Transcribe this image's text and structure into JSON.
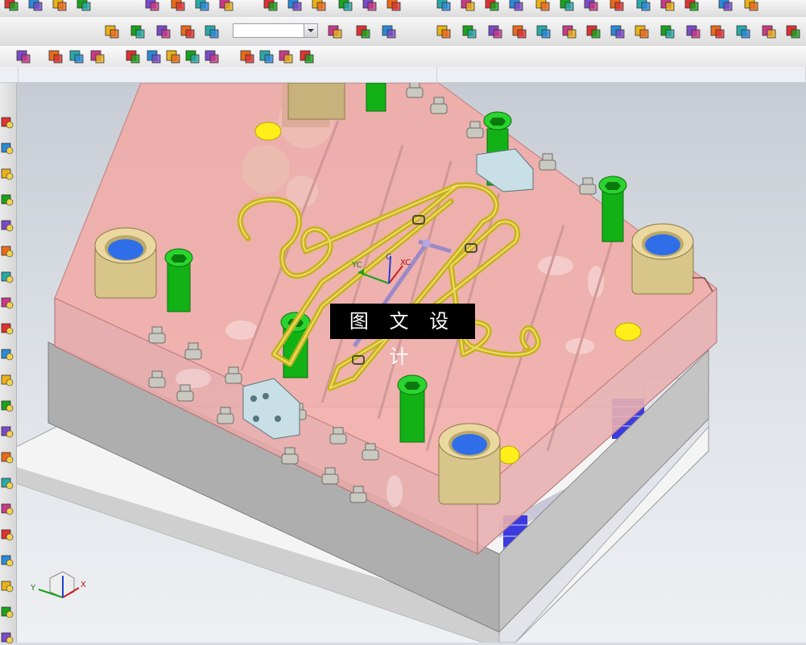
{
  "toolbar": {
    "combo_value": ""
  },
  "viewport": {
    "watermark_text": "图 文 设 计",
    "wcs_label_yc": "YC",
    "wcs_label_xc": "XC",
    "wcs_label_zc": "C",
    "triad_label_x": "X",
    "triad_label_y": "Y"
  },
  "colors": {
    "plate_pink": "#f2a5a1",
    "hanger_yellow": "#c8b21a",
    "bolt_green": "#16b81a",
    "bushing_blue": "#2f6ee8",
    "bushing_brass": "#e3d09a"
  },
  "icons": {
    "toolbar_row1": [
      "sketch-icon",
      "dimension-icon",
      "home-icon",
      "cylinder-icon",
      "check-icon",
      "table-icon",
      "edit-icon",
      "view-icon",
      "analysis-icon",
      "grid-icon",
      "cube-icon",
      "box-icon",
      "move-icon",
      "tools-icon",
      "layer-icon",
      "shade-icon",
      "fill-icon",
      "stack-icon",
      "scale-icon",
      "truck-icon",
      "bridge-icon",
      "image-icon",
      "gear-icon",
      "lamp-icon",
      "settings-icon",
      "grid-table-icon",
      "window-icon"
    ],
    "toolbar_row2": [
      "gear-cluster-icon",
      "chain-icon",
      "wrench-icon",
      "thumb-icon",
      "cut-icon",
      "arrow-box-icon",
      "cube-yellow-icon",
      "curve-icon",
      "red-box-icon",
      "diamond-icon",
      "blue-cube-icon",
      "layer-icon",
      "palette-icon",
      "grid-color-icon",
      "split-icon",
      "line-icon",
      "target-icon",
      "parallel-icon",
      "view-grid-icon",
      "stack-color-icon",
      "isometric-icon",
      "angle-icon",
      "corner-icon"
    ],
    "toolbar_row3": [
      "select-rect-icon",
      "shape-icon",
      "pattern-icon",
      "snap-icon",
      "line-icon",
      "curve-icon",
      "perpendicular-icon",
      "circle-center-icon",
      "point-icon",
      "plus-icon",
      "intersect-icon",
      "tangent-icon",
      "filter-icon"
    ]
  }
}
